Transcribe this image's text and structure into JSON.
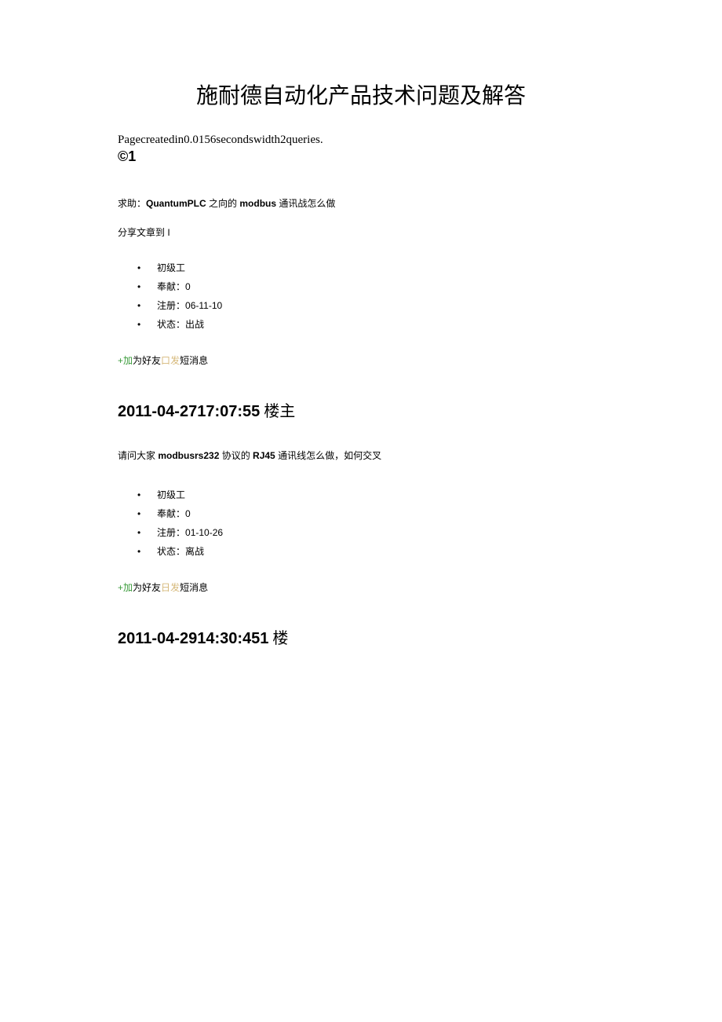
{
  "title": "施耐德自动化产品技术问题及解答",
  "footer": "Pagecreatedin0.0156secondswidth2queries.",
  "copyright": "©1",
  "posts": [
    {
      "topic_prefix": "求助：",
      "topic_b1": "QuantumPLC",
      "topic_mid1": " 之向的 ",
      "topic_b2": "modbus",
      "topic_mid2": " 通讯战怎么做",
      "share": "分享文章到 I",
      "info": {
        "rank": "初级工",
        "contrib_label": "奉献：",
        "contrib_value": "0",
        "reg_label": "注册：",
        "reg_value": "06-11-10",
        "status_label": "状态：",
        "status_value": "出战"
      },
      "actions": {
        "plus": "+",
        "add": "加",
        "friend": "为好友",
        "marker": "口",
        "send": "发",
        "msg": "短消息"
      },
      "header_time": "2011-04-2717:07:55",
      "header_floor": " 楼主",
      "body_pre": "请问大家 ",
      "body_b1": "modbusrs232",
      "body_mid1": " 协议的 ",
      "body_b2": "RJ45",
      "body_mid2": " 通讯线怎么做，如何交叉"
    },
    {
      "info": {
        "rank": "初级工",
        "contrib_label": "奉献：",
        "contrib_value": "0",
        "reg_label": "注册：",
        "reg_value": "01-10-26",
        "status_label": "状态：",
        "status_value": "离战"
      },
      "actions": {
        "plus": "+",
        "add": "加",
        "friend": "为好友",
        "marker": "日",
        "send": "发",
        "msg": "短消息"
      },
      "header_time": "2011-04-2914:30:451",
      "header_floor": " 楼"
    }
  ]
}
